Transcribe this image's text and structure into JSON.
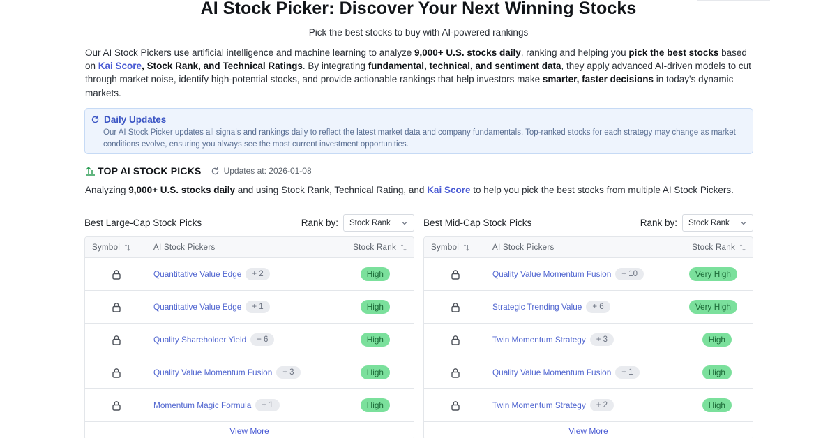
{
  "title": "AI Stock Picker: Discover Your Next Winning Stocks",
  "subtitle": "Pick the best stocks to buy with AI-powered rankings",
  "intro": {
    "p1": "Our AI Stock Pickers use artificial intelligence and machine learning to analyze ",
    "b1": "9,000+ U.S. stocks daily",
    "p2": ", ranking and helping you ",
    "b2": "pick the best stocks",
    "p3": " based on ",
    "link1": "Kai Score",
    "b3": ", Stock Rank, and Technical Ratings",
    "p4": ". By integrating ",
    "b4": "fundamental, technical, and sentiment data",
    "p5": ", they apply advanced AI-driven models to cut through market noise, identify high-potential stocks, and provide actionable rankings that help investors make ",
    "b5": "smarter, faster decisions",
    "p6": " in today's dynamic markets."
  },
  "notice": {
    "title": "Daily Updates",
    "text": "Our AI Stock Picker updates all signals and rankings daily to reflect the latest market data and company fundamentals. Top-ranked stocks for each strategy may change as market conditions evolve, ensuring you always see the most current investment opportunities."
  },
  "picks": {
    "title": "TOP AI STOCK PICKS",
    "updates": "Updates at: 2026-01-08"
  },
  "analyzing": {
    "p1": "Analyzing ",
    "b1": "9,000+ U.S. stocks daily",
    "p2": " and using Stock Rank, Technical Rating, and ",
    "link1": "Kai Score",
    "p3": " to help you pick the best stocks from multiple AI Stock Pickers."
  },
  "rank_label": "Rank by:",
  "headers": {
    "symbol": "Symbol",
    "pickers": "AI Stock Pickers",
    "rank": "Stock Rank"
  },
  "view_more": "View More",
  "large_cap": {
    "title": "Best Large-Cap Stock Picks",
    "rank_select": "Stock Rank",
    "rows": [
      {
        "picker": "Quantitative Value Edge",
        "more": "+ 2",
        "rank": "High"
      },
      {
        "picker": "Quantitative Value Edge",
        "more": "+ 1",
        "rank": "High"
      },
      {
        "picker": "Quality Shareholder Yield",
        "more": "+ 6",
        "rank": "High"
      },
      {
        "picker": "Quality Value Momentum Fusion",
        "more": "+ 3",
        "rank": "High"
      },
      {
        "picker": "Momentum Magic Formula",
        "more": "+ 1",
        "rank": "High"
      }
    ]
  },
  "mid_cap": {
    "title": "Best Mid-Cap Stock Picks",
    "rank_select": "Stock Rank",
    "rows": [
      {
        "picker": "Quality Value Momentum Fusion",
        "more": "+ 10",
        "rank": "Very High"
      },
      {
        "picker": "Strategic Trending Value",
        "more": "+ 6",
        "rank": "Very High"
      },
      {
        "picker": "Twin Momentum Strategy",
        "more": "+ 3",
        "rank": "High"
      },
      {
        "picker": "Quality Value Momentum Fusion",
        "more": "+ 1",
        "rank": "High"
      },
      {
        "picker": "Twin Momentum Strategy",
        "more": "+ 2",
        "rank": "High"
      }
    ]
  },
  "colors": {
    "accent": "#4a5bd4",
    "badge_green": "#7be09c",
    "notice_bg": "#eef4fd"
  },
  "icons": {
    "lock": "lock-icon",
    "sort": "sort-icon",
    "refresh": "refresh-icon",
    "trend": "trending-up-icon",
    "chevron": "chevron-down-icon"
  }
}
